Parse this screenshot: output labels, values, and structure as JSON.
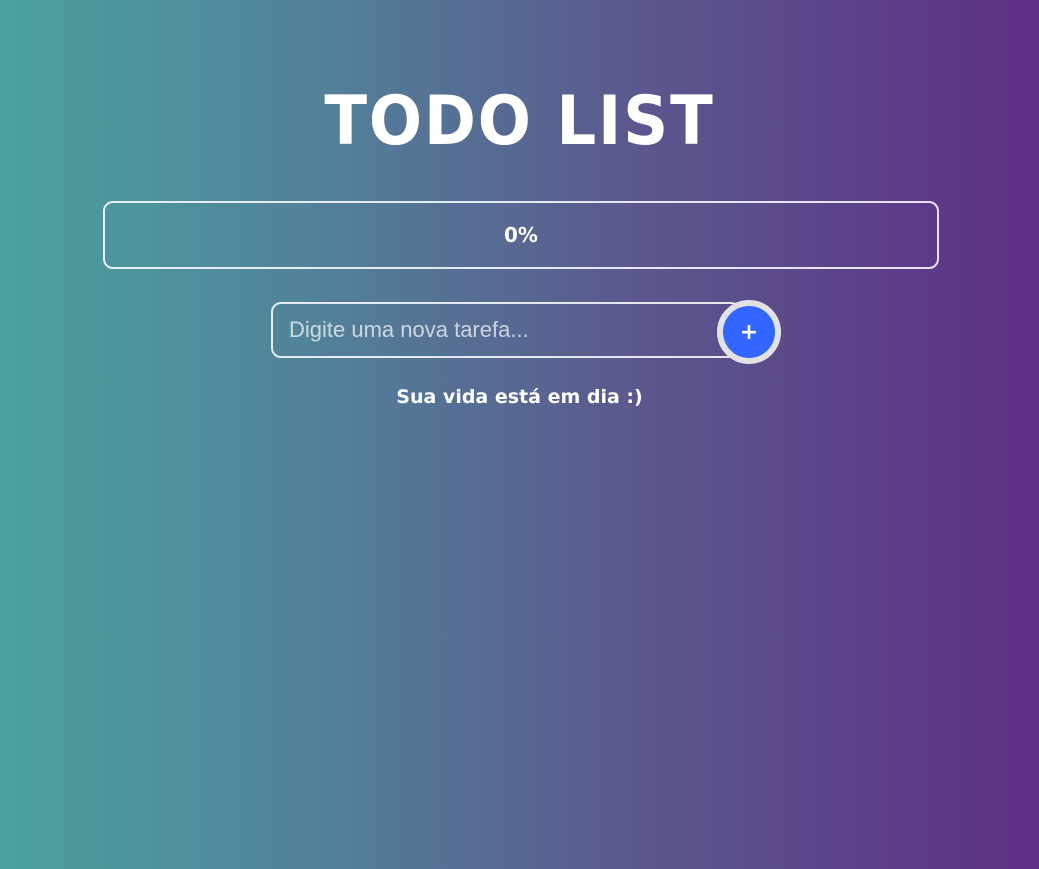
{
  "header": {
    "title": "TODO LIST"
  },
  "progress": {
    "label": "0%",
    "value_percent": 0
  },
  "new_task": {
    "placeholder": "Digite uma nova tarefa...",
    "value": "",
    "add_label": "+"
  },
  "tasks": [],
  "empty_state": {
    "message": "Sua vida está em dia :)"
  },
  "colors": {
    "gradient_start": "#4aa19e",
    "gradient_end": "#5e2f85",
    "add_button": "#3366ff",
    "add_button_ring": "#e2e2e6",
    "text": "#ffffff"
  },
  "icons": {
    "add": "plus-icon"
  }
}
